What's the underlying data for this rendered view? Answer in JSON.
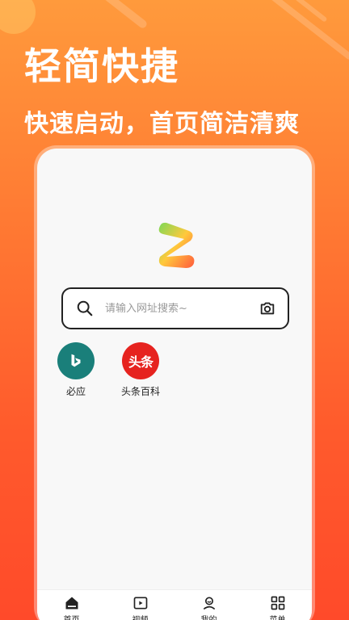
{
  "promo": {
    "headline": "轻简快捷",
    "subline": "快速启动，首页简洁清爽"
  },
  "search": {
    "placeholder": "请输入网址搜索~",
    "icon": "search-icon",
    "camera_icon": "camera-icon"
  },
  "shortcuts": [
    {
      "label": "必应",
      "icon": "bing-icon",
      "color": "#1a7f7a"
    },
    {
      "label": "头条百科",
      "icon_text": "头条",
      "color": "#e6231f"
    }
  ],
  "bottom_nav": [
    {
      "label": "首页",
      "icon": "home-icon"
    },
    {
      "label": "视频",
      "icon": "video-icon"
    },
    {
      "label": "我的",
      "icon": "user-icon"
    },
    {
      "label": "菜单",
      "icon": "menu-grid-icon"
    }
  ],
  "colors": {
    "background_top": "#ff9a3c",
    "background_bottom": "#ff4a2a",
    "text_on_background": "#ffffff"
  }
}
